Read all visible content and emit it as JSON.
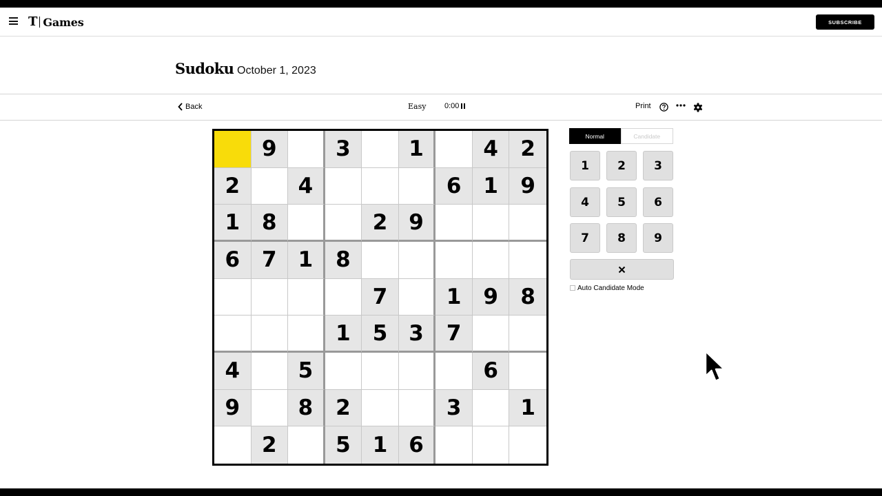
{
  "header": {
    "logo_t": "T",
    "logo_games": "Games",
    "subscribe_label": "SUBSCRIBE"
  },
  "puzzle": {
    "title": "Sudoku",
    "date": "October 1, 2023"
  },
  "toolbar": {
    "back_label": "Back",
    "difficulty": "Easy",
    "timer": "0:00",
    "print_label": "Print"
  },
  "board": {
    "selected_cell": [
      0,
      0
    ],
    "rows": [
      [
        "",
        "9",
        "",
        "3",
        "",
        "1",
        "",
        "4",
        "2"
      ],
      [
        "2",
        "",
        "4",
        "",
        "",
        "",
        "6",
        "1",
        "9"
      ],
      [
        "1",
        "8",
        "",
        "",
        "2",
        "9",
        "",
        "",
        ""
      ],
      [
        "6",
        "7",
        "1",
        "8",
        "",
        "",
        "",
        "",
        ""
      ],
      [
        "",
        "",
        "",
        "",
        "7",
        "",
        "1",
        "9",
        "8"
      ],
      [
        "",
        "",
        "",
        "1",
        "5",
        "3",
        "7",
        "",
        ""
      ],
      [
        "4",
        "",
        "5",
        "",
        "",
        "",
        "",
        "6",
        ""
      ],
      [
        "9",
        "",
        "8",
        "2",
        "",
        "",
        "3",
        "",
        "1"
      ],
      [
        "",
        "2",
        "",
        "5",
        "1",
        "6",
        "",
        "",
        ""
      ]
    ]
  },
  "controls": {
    "mode_normal": "Normal",
    "mode_candidate": "Candidate",
    "active_mode": "Normal",
    "numbers": [
      "1",
      "2",
      "3",
      "4",
      "5",
      "6",
      "7",
      "8",
      "9"
    ],
    "erase_symbol": "✕",
    "auto_candidate_label": "Auto Candidate Mode",
    "auto_candidate_checked": false
  },
  "colors": {
    "selected_cell": "#f8dc0a",
    "prefilled_cell": "#e6e6e6",
    "accent": "#000000"
  },
  "icons": [
    "hamburger-menu-icon",
    "nyt-logo-icon",
    "chevron-left-icon",
    "pause-icon",
    "help-icon",
    "more-dots-icon",
    "gear-icon",
    "erase-icon",
    "mouse-pointer-icon"
  ]
}
